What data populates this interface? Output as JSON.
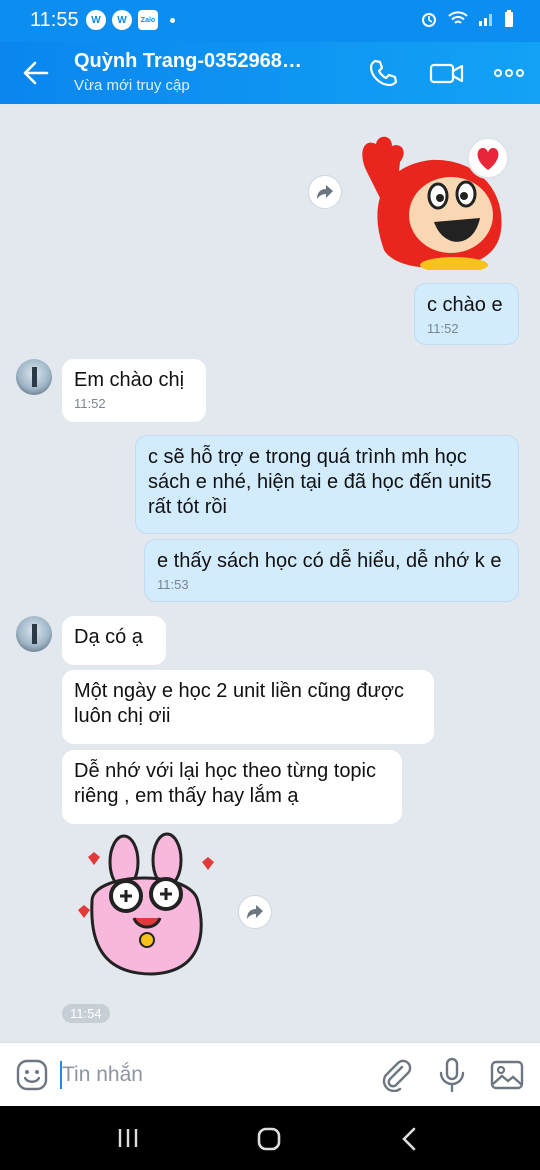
{
  "status_bar": {
    "time": "11:55",
    "zalo_label": "Zalo"
  },
  "header": {
    "name": "Quỳnh Trang-0352968…",
    "status": "Vừa mới truy cập"
  },
  "messages": {
    "m1": {
      "text": "c chào e",
      "time": "11:52"
    },
    "m2": {
      "text": "Em chào chị",
      "time": "11:52"
    },
    "m3": {
      "line1": "c sẽ hỗ trợ e trong quá trình mh học",
      "line2": "sách e nhé, hiện tại e đã học đến unit5",
      "line3": "rất tót rồi"
    },
    "m4": {
      "text": "e thấy sách học có dễ hiểu, dễ nhớ k e",
      "time": "11:53"
    },
    "m5": {
      "text": "Dạ có ạ"
    },
    "m6": {
      "line1": "Một ngày e học 2 unit liền cũng được",
      "line2": "luôn chị ơii"
    },
    "m7": {
      "line1": "Dễ nhớ với lại học theo từng topic",
      "line2": "riêng , em thấy hay lắm ạ"
    },
    "sticker_time": "11:54"
  },
  "input": {
    "placeholder": "Tin nhắn"
  },
  "icons": {
    "back": "arrow-left-icon",
    "call": "phone-icon",
    "video": "video-icon",
    "more": "more-icon",
    "forward": "share-forward-icon",
    "emoji": "emoji-icon",
    "attach": "paperclip-icon",
    "mic": "microphone-icon",
    "image": "image-icon"
  },
  "colors": {
    "header": "#0c8ef0",
    "my_bubble": "#d3ecfd",
    "their_bubble": "#ffffff",
    "chat_bg": "#e3e7ee"
  }
}
